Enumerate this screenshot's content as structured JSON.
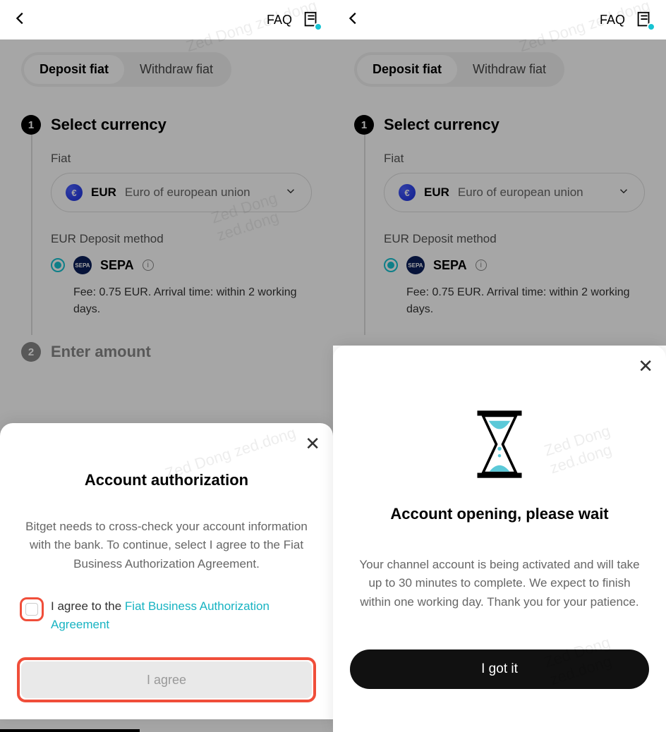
{
  "header": {
    "faq_label": "FAQ"
  },
  "tabs": {
    "deposit": "Deposit fiat",
    "withdraw": "Withdraw fiat"
  },
  "steps": {
    "select_currency": {
      "num": "1",
      "title": "Select currency"
    },
    "enter_amount": {
      "num": "2",
      "title": "Enter amount"
    }
  },
  "currency": {
    "label": "Fiat",
    "code": "EUR",
    "name": "Euro of european union",
    "method_label": "EUR Deposit method",
    "sepa_name": "SEPA",
    "sepa_badge": "SEPA",
    "fee_text": "Fee: 0.75 EUR. Arrival time: within 2 working days."
  },
  "sheet_auth": {
    "title": "Account authorization",
    "body": "Bitget needs to cross-check your account information with the bank. To continue, select I agree to the Fiat Business Authorization Agreement.",
    "agree_prefix": "I agree to the ",
    "agree_link": "Fiat Business Authorization Agreement",
    "button": "I agree"
  },
  "sheet_wait": {
    "title": "Account opening, please wait",
    "body": "Your channel account is being activated and will take up to 30 minutes to complete. We expect to finish within one working day. Thank you for your patience.",
    "button": "I got it"
  },
  "watermark": "Zed Dong zed.dong"
}
